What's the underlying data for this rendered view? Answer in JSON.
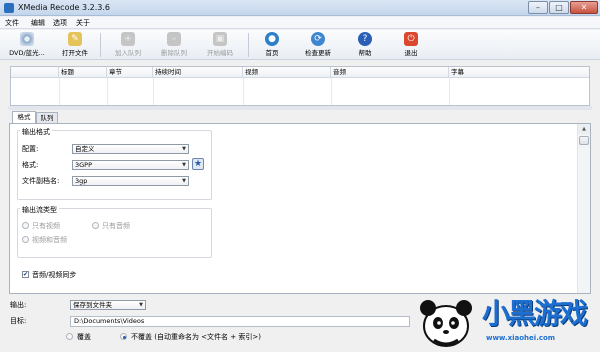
{
  "window": {
    "title": "XMedia Recode 3.2.3.6",
    "controls": {
      "minimize": "–",
      "maximize": "□",
      "close": "✕"
    }
  },
  "menu": [
    "文件",
    "编辑",
    "选项",
    "关于"
  ],
  "toolbar": {
    "items": [
      {
        "label": "DVD/蓝光...",
        "icon": "dvd-icon",
        "enabled": true
      },
      {
        "label": "打开文件",
        "icon": "open-file-icon",
        "enabled": true
      },
      {
        "label": "加入队列",
        "icon": "add-queue-icon",
        "enabled": false
      },
      {
        "label": "删除队列",
        "icon": "remove-queue-icon",
        "enabled": false
      },
      {
        "label": "开始编码",
        "icon": "start-encode-icon",
        "enabled": false
      },
      {
        "label": "首页",
        "icon": "home-icon",
        "enabled": true
      },
      {
        "label": "检查更新",
        "icon": "update-icon",
        "enabled": true
      },
      {
        "label": "帮助",
        "icon": "help-icon",
        "enabled": true
      },
      {
        "label": "退出",
        "icon": "exit-icon",
        "enabled": true
      }
    ]
  },
  "file_table": {
    "columns": [
      "标题",
      "章节",
      "持续时间",
      "视频",
      "音频",
      "字幕"
    ]
  },
  "tabs": [
    "格式",
    "队列"
  ],
  "format_panel": {
    "output_format_group": "输出格式",
    "profile_label": "配置:",
    "profile_value": "自定义",
    "format_label": "格式:",
    "format_value": "3GPP",
    "extension_label": "文件副档名:",
    "extension_value": "3gp",
    "stream_type_group": "输出流类型",
    "stream_options": [
      "只有视频",
      "只有音频",
      "视频和音频"
    ],
    "sync_label": "音频/视频同步",
    "sync_checked": true
  },
  "output": {
    "output_label": "输出:",
    "output_value": "保存到文件夹",
    "target_label": "目标:",
    "target_value": "D:\\Documents\\Videos",
    "overwrite_label": "覆盖",
    "no_overwrite_label": "不覆盖 (自动重命名为 <文件名 + 索引>)",
    "selected": "no_overwrite"
  },
  "watermark": {
    "brand": "小黑游戏",
    "url": "www.xiaohei.com"
  },
  "colors": {
    "titlebar": "#c4d6ec",
    "accent_blue": "#2b6fbf",
    "close_red": "#c7513f",
    "watermark_blue": "#1c6fd1"
  }
}
